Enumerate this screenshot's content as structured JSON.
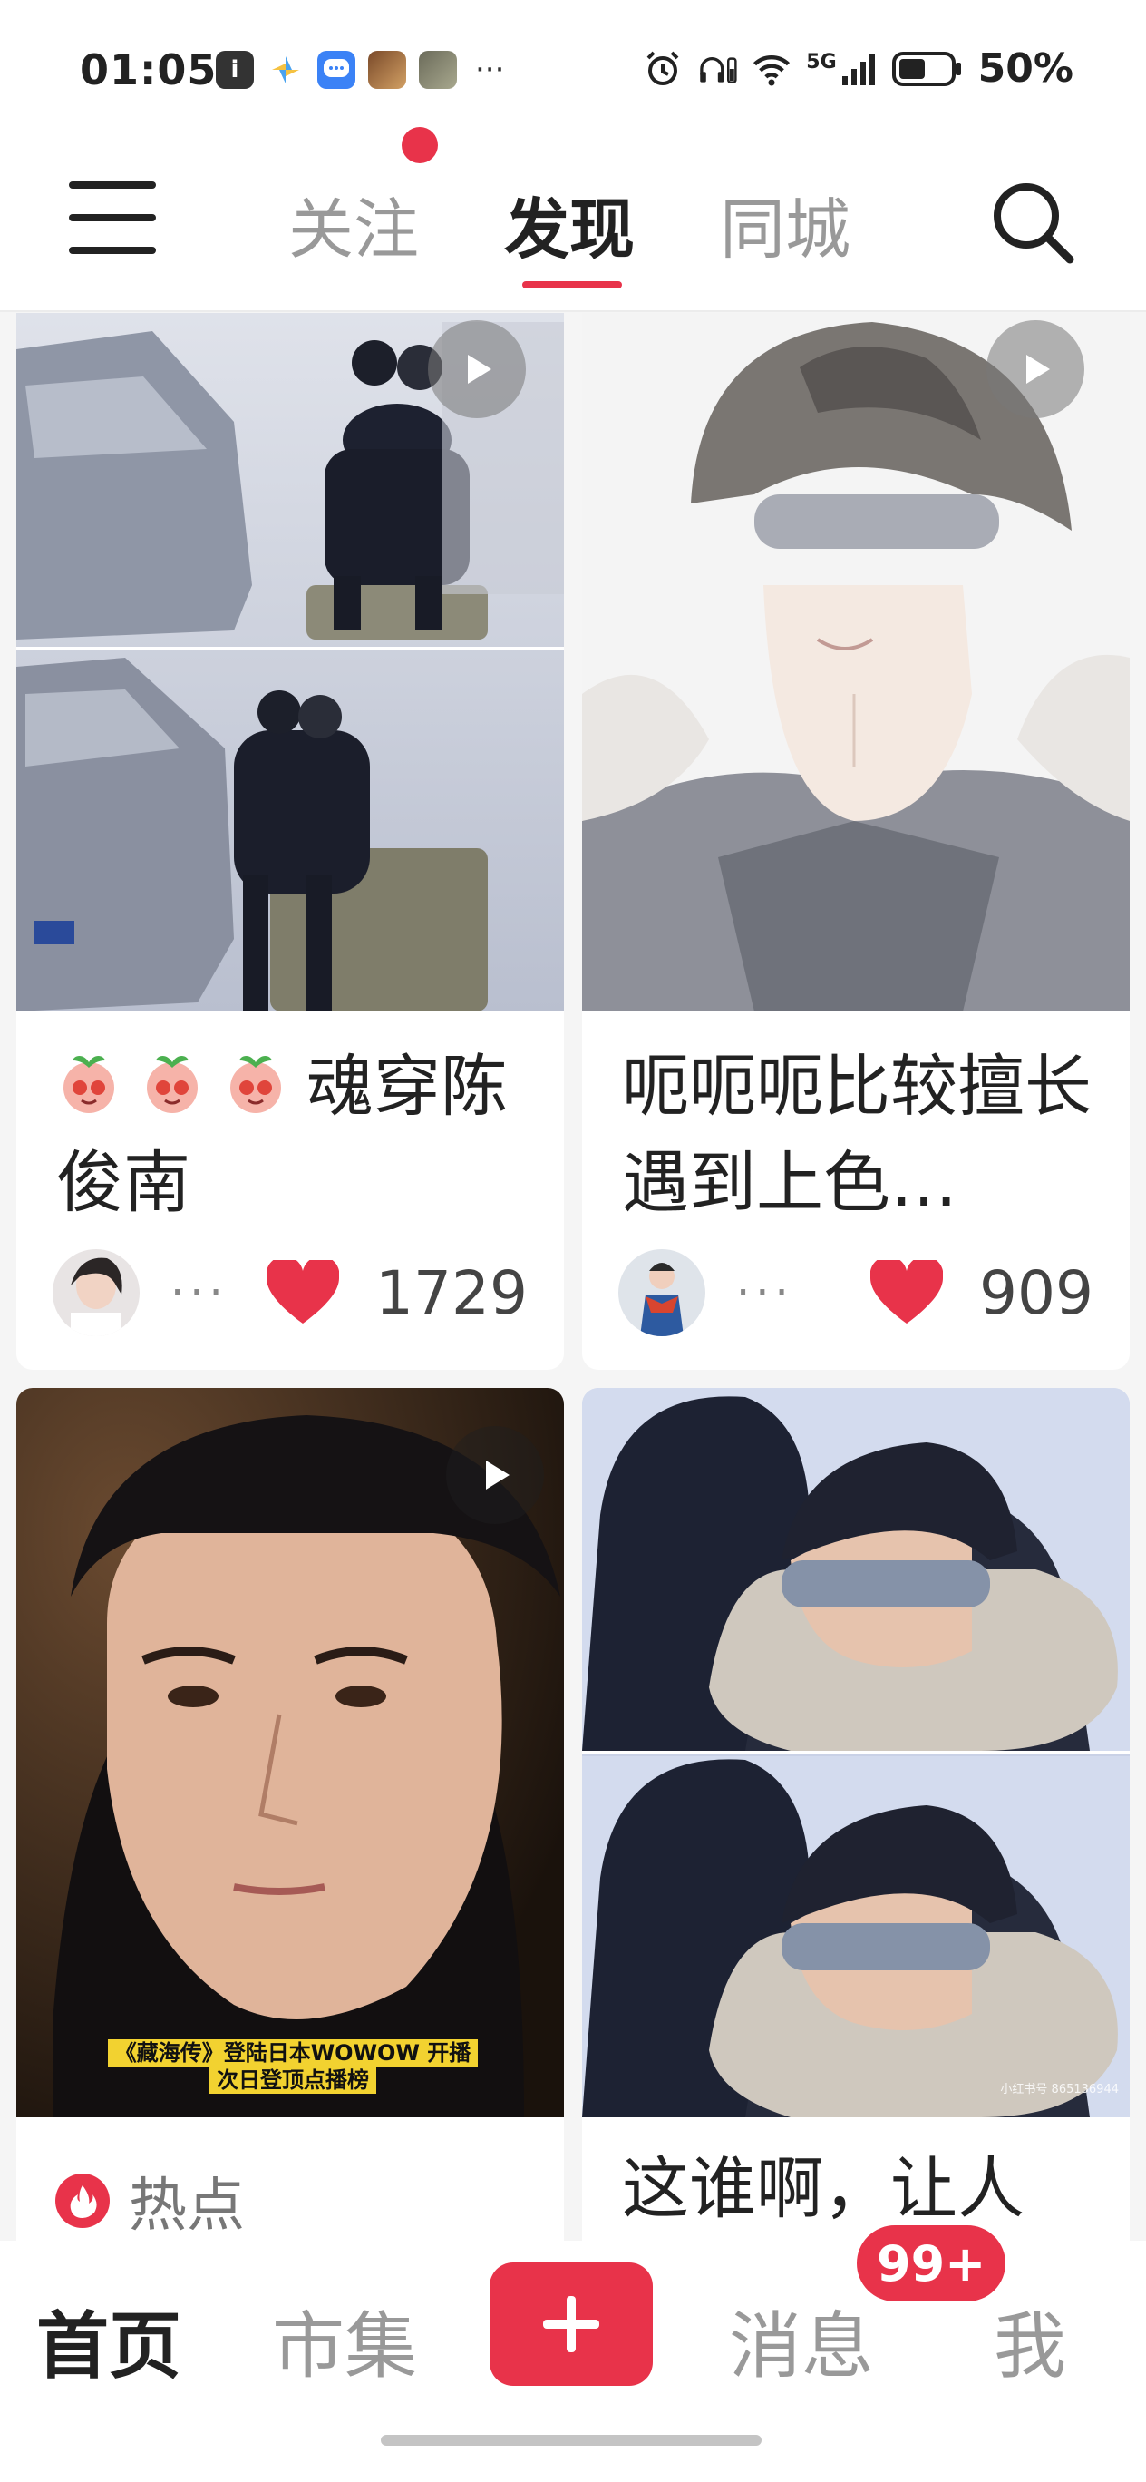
{
  "status": {
    "time": "01:05",
    "more": "···",
    "network": "5G",
    "battery": "50%"
  },
  "nav": {
    "tabs": [
      {
        "label": "关注",
        "active": false
      },
      {
        "label": "发现",
        "active": true
      },
      {
        "label": "同城",
        "active": false
      }
    ],
    "accent": "#e8334a"
  },
  "feed": [
    {
      "title": "魂穿陈俊南",
      "author": "···",
      "likes": "1729",
      "has_video": true
    },
    {
      "title": "呃呃呃比较擅长遇到上色…",
      "author": "···",
      "likes": "909",
      "has_video": true
    },
    {
      "caption_line1": "《藏海传》登陆日本WOWOW 开播",
      "caption_line2": "次日登顶点播榜",
      "tag": "热点",
      "has_video": true
    },
    {
      "title": "这谁啊，让人",
      "watermark": "小红书号 865136944"
    }
  ],
  "bottom_nav": {
    "items": [
      {
        "label": "首页",
        "active": true
      },
      {
        "label": "市集",
        "active": false
      },
      {
        "label": "消息",
        "active": false
      },
      {
        "label": "我",
        "active": false
      }
    ],
    "badge": "99+"
  }
}
